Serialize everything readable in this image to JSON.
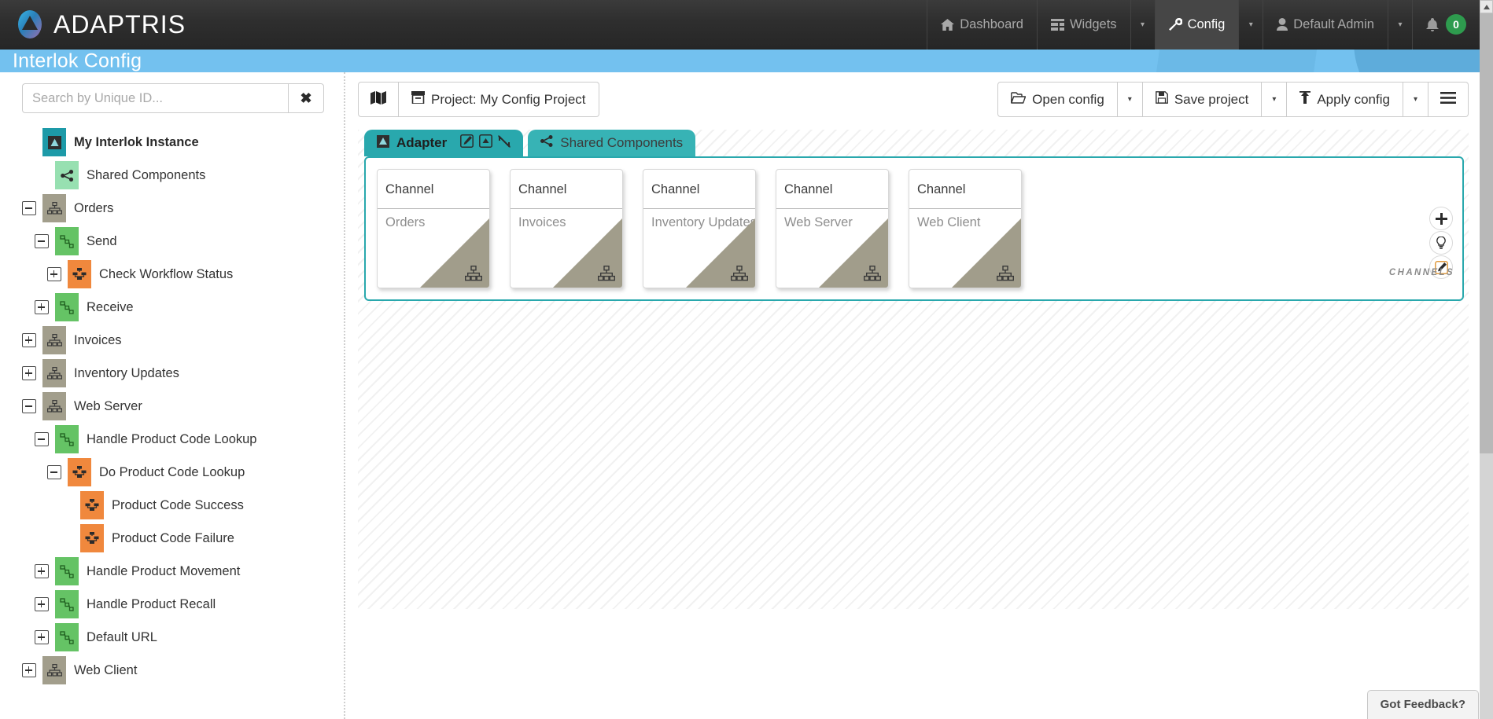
{
  "app": {
    "brand": "ADAPTRIS",
    "brand_logo_icon": "adaptris-logo-icon",
    "page_title": "Interlok Config"
  },
  "topnav": {
    "items": [
      {
        "label": "Dashboard",
        "icon": "home-icon",
        "active": false,
        "has_caret": false
      },
      {
        "label": "Widgets",
        "icon": "widgets-icon",
        "active": false,
        "has_caret": true
      },
      {
        "label": "Config",
        "icon": "wrench-icon",
        "active": true,
        "has_caret": true
      },
      {
        "label": "Default Admin",
        "icon": "user-icon",
        "active": false,
        "has_caret": true
      }
    ],
    "notifications": {
      "icon": "bell-icon",
      "count": "0",
      "badge_color": "#2e9b4e"
    },
    "caret_glyph": "▾"
  },
  "sidebar": {
    "search": {
      "placeholder": "Search by Unique ID...",
      "value": "",
      "clear_label": "✖",
      "clear_icon": "clear-x-icon"
    },
    "tree": [
      {
        "label": "My Interlok Instance",
        "indent": 0,
        "toggle": "none",
        "icon": "adapter-instance-icon",
        "icon_class": "ic-instance",
        "bold": true
      },
      {
        "label": "Shared Components",
        "indent": 1,
        "toggle": "none",
        "icon": "share-nodes-icon",
        "icon_class": "ic-shared",
        "bold": false
      },
      {
        "label": "Orders",
        "indent": 0,
        "toggle": "minus",
        "icon": "channel-icon",
        "icon_class": "ic-channel",
        "bold": false
      },
      {
        "label": "Send",
        "indent": 1,
        "toggle": "minus",
        "icon": "workflow-icon",
        "icon_class": "ic-workflow",
        "bold": false
      },
      {
        "label": "Check Workflow Status",
        "indent": 2,
        "toggle": "plus",
        "icon": "service-icon",
        "icon_class": "ic-service",
        "bold": false
      },
      {
        "label": "Receive",
        "indent": 1,
        "toggle": "plus",
        "icon": "workflow-icon",
        "icon_class": "ic-workflow",
        "bold": false
      },
      {
        "label": "Invoices",
        "indent": 0,
        "toggle": "plus",
        "icon": "channel-icon",
        "icon_class": "ic-channel",
        "bold": false
      },
      {
        "label": "Inventory Updates",
        "indent": 0,
        "toggle": "plus",
        "icon": "channel-icon",
        "icon_class": "ic-channel",
        "bold": false
      },
      {
        "label": "Web Server",
        "indent": 0,
        "toggle": "minus",
        "icon": "channel-icon",
        "icon_class": "ic-channel",
        "bold": false
      },
      {
        "label": "Handle Product Code Lookup",
        "indent": 1,
        "toggle": "minus",
        "icon": "workflow-icon",
        "icon_class": "ic-workflow",
        "bold": false
      },
      {
        "label": "Do Product Code Lookup",
        "indent": 2,
        "toggle": "minus",
        "icon": "service-icon",
        "icon_class": "ic-service",
        "bold": false
      },
      {
        "label": "Product Code Success",
        "indent": 3,
        "toggle": "none",
        "icon": "service-icon",
        "icon_class": "ic-service",
        "bold": false
      },
      {
        "label": "Product Code Failure",
        "indent": 3,
        "toggle": "none",
        "icon": "service-icon",
        "icon_class": "ic-service",
        "bold": false
      },
      {
        "label": "Handle Product Movement",
        "indent": 1,
        "toggle": "plus",
        "icon": "workflow-icon",
        "icon_class": "ic-workflow",
        "bold": false
      },
      {
        "label": "Handle Product Recall",
        "indent": 1,
        "toggle": "plus",
        "icon": "workflow-icon",
        "icon_class": "ic-workflow",
        "bold": false
      },
      {
        "label": "Default URL",
        "indent": 1,
        "toggle": "plus",
        "icon": "workflow-icon",
        "icon_class": "ic-workflow",
        "bold": false
      },
      {
        "label": "Web Client",
        "indent": 0,
        "toggle": "plus",
        "icon": "channel-icon",
        "icon_class": "ic-channel",
        "bold": false
      }
    ]
  },
  "toolbar": {
    "map_button_icon": "map-icon",
    "project_icon": "project-box-icon",
    "project_label": "Project: My Config Project",
    "open_config_label": "Open config",
    "open_config_icon": "folder-open-icon",
    "save_project_label": "Save project",
    "save_project_icon": "floppy-disk-icon",
    "apply_config_label": "Apply config",
    "apply_config_icon": "upload-arrow-icon",
    "menu_icon": "hamburger-menu-icon",
    "caret_glyph": "▾"
  },
  "canvas": {
    "tabs": [
      {
        "label": "Adapter",
        "icon": "adapter-instance-icon",
        "active": true
      },
      {
        "label": "Shared Components",
        "icon": "share-nodes-icon",
        "active": false
      }
    ],
    "tab_tools": [
      {
        "name": "edit-adapter-icon"
      },
      {
        "name": "collapse-up-icon"
      },
      {
        "name": "shrink-icon"
      }
    ],
    "section_label": "CHANNELS",
    "tools": [
      {
        "name": "add-channel-icon",
        "glyph": "+"
      },
      {
        "name": "hint-bulb-icon",
        "glyph": "bulb"
      },
      {
        "name": "edit-pencil-icon",
        "glyph": "pencil"
      }
    ],
    "accent_color": "#29a8ad",
    "cards": [
      {
        "type": "Channel",
        "name": "Orders",
        "corner_icon": "channel-hierarchy-icon"
      },
      {
        "type": "Channel",
        "name": "Invoices",
        "corner_icon": "channel-hierarchy-icon"
      },
      {
        "type": "Channel",
        "name": "Inventory Updates",
        "corner_icon": "channel-hierarchy-icon"
      },
      {
        "type": "Channel",
        "name": "Web Server",
        "corner_icon": "channel-hierarchy-icon"
      },
      {
        "type": "Channel",
        "name": "Web Client",
        "corner_icon": "channel-hierarchy-icon"
      }
    ]
  },
  "feedback": {
    "label": "Got Feedback?"
  },
  "scrollbar": {
    "up_arrow": "▲",
    "icon": "scrollbar-up-icon"
  }
}
